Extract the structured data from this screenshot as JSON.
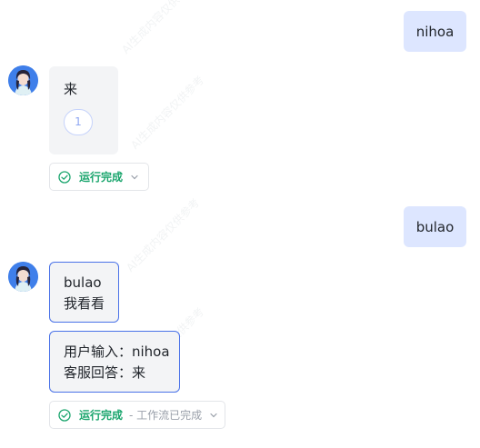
{
  "watermark": "AI生成内容仅供参考",
  "messages": [
    {
      "role": "user",
      "text": "nihoa"
    },
    {
      "role": "bot",
      "lines": [
        "来"
      ],
      "citation": "1",
      "status": "运行完成"
    },
    {
      "role": "user",
      "text": "bulao"
    },
    {
      "role": "bot",
      "bubbles": [
        {
          "lines": [
            "bulao",
            "我看看"
          ]
        },
        {
          "lines": [
            "用户输入：nihoa",
            "客服回答：来"
          ]
        }
      ],
      "status": "运行完成",
      "status_detail": "- 工作流已完成"
    }
  ],
  "colors": {
    "user_bubble": "#dde6ff",
    "bot_bubble": "#f3f4f6",
    "accent_border": "#4a72e8",
    "success": "#1aa56d"
  },
  "icons": [
    "avatar",
    "check-circle-icon",
    "chevron-down-icon"
  ]
}
